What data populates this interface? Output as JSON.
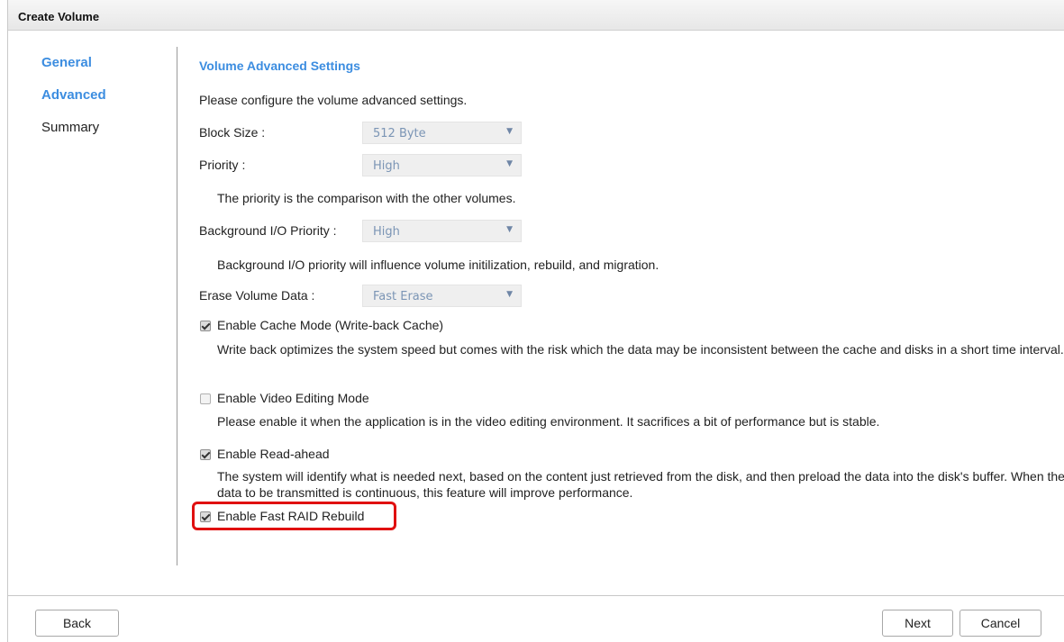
{
  "dialog": {
    "title": "Create Volume"
  },
  "nav": {
    "items": [
      {
        "label": "General",
        "active": true
      },
      {
        "label": "Advanced",
        "active": true
      },
      {
        "label": "Summary",
        "active": false
      }
    ]
  },
  "main": {
    "section_title": "Volume Advanced Settings",
    "intro": "Please configure the volume advanced settings.",
    "block_size": {
      "label": "Block Size :",
      "value": "512 Byte"
    },
    "priority": {
      "label": "Priority :",
      "value": "High",
      "note": "The priority is the comparison with the other volumes."
    },
    "bg_priority": {
      "label": "Background I/O Priority :",
      "value": "High",
      "note": "Background I/O priority will influence volume initilization, rebuild, and migration."
    },
    "erase": {
      "label": "Erase Volume Data :",
      "value": "Fast Erase"
    },
    "cache_mode": {
      "label": "Enable Cache Mode (Write-back Cache)",
      "checked": true,
      "desc": "Write back optimizes the system speed but comes with the risk which the data may be inconsistent between the cache and disks in a short time interval."
    },
    "video_mode": {
      "label": "Enable Video Editing Mode",
      "checked": false,
      "desc": "Please enable it when the application is in the video editing environment. It sacrifices a bit of performance but is stable."
    },
    "read_ahead": {
      "label": "Enable Read-ahead",
      "checked": true,
      "desc": "The system will identify what is needed next, based on the content just retrieved from the disk, and then preload the data into the disk's buffer. When the data to be transmitted is continuous, this feature will improve performance."
    },
    "fast_rebuild": {
      "label": "Enable Fast RAID Rebuild",
      "checked": true
    }
  },
  "footer": {
    "back": "Back",
    "next": "Next",
    "cancel": "Cancel"
  },
  "colors": {
    "accent": "#3c8de0",
    "highlight": "#e01010"
  },
  "icons": {
    "dropdown": "dropdown-arrow-icon",
    "check": "checkmark-icon"
  }
}
